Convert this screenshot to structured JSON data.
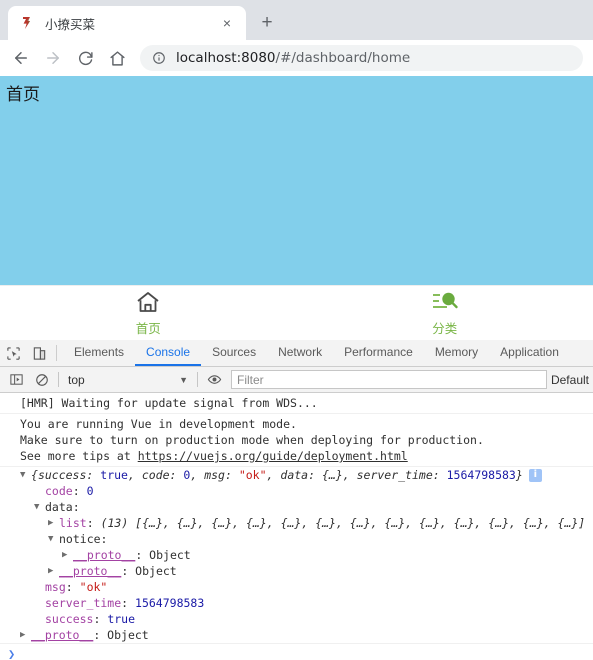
{
  "browser": {
    "tab": {
      "title": "小撩买菜",
      "favicon": "brand-b-icon",
      "close_label": "×"
    },
    "new_tab_label": "+",
    "nav": {
      "back": "back-arrow",
      "forward": "forward-arrow",
      "reload": "reload-arrow",
      "home": "home-outline"
    },
    "omnibox": {
      "security_icon": "info-circle-icon",
      "url_host": "localhost:8080",
      "url_path": "/#/dashboard/home"
    }
  },
  "page": {
    "header_title": "首页",
    "background_color": "#82cfeb",
    "accent_color": "#7ab648",
    "tabbar": [
      {
        "icon": "home-icon",
        "label": "首页"
      },
      {
        "icon": "category-search-icon",
        "label": "分类"
      }
    ]
  },
  "devtools": {
    "tools": {
      "inspect": "inspect-element-icon",
      "device": "device-toolbar-icon"
    },
    "tabs": [
      {
        "label": "Elements",
        "active": false
      },
      {
        "label": "Console",
        "active": true
      },
      {
        "label": "Sources",
        "active": false
      },
      {
        "label": "Network",
        "active": false
      },
      {
        "label": "Performance",
        "active": false
      },
      {
        "label": "Memory",
        "active": false
      },
      {
        "label": "Application",
        "active": false
      }
    ],
    "console_toolbar": {
      "execute_icon": "execute-sidebar-icon",
      "clear_icon": "clear-console-icon",
      "context": "top",
      "caret": "▼",
      "eye_icon": "live-expression-icon",
      "filter_placeholder": "Filter",
      "levels": "Default"
    },
    "console": {
      "messages": [
        {
          "type": "text",
          "lines": [
            "[HMR] Waiting for update signal from WDS..."
          ]
        },
        {
          "type": "text",
          "lines": [
            "You are running Vue in development mode.",
            "Make sure to turn on production mode when deploying for production.",
            "See more tips at "
          ],
          "link": "https://vuejs.org/guide/deployment.html"
        }
      ],
      "object_log": {
        "summary": {
          "triangle": "▼",
          "open": "{",
          "parts": [
            {
              "key": "success",
              "sep": ": ",
              "value": "true",
              "kind": "bool"
            },
            {
              "key": "code",
              "sep": ": ",
              "value": "0",
              "kind": "num"
            },
            {
              "key": "msg",
              "sep": ": ",
              "value": "\"ok\"",
              "kind": "str"
            },
            {
              "key": "data",
              "sep": ": ",
              "value": "{…}",
              "kind": "obj"
            },
            {
              "key": "server_time",
              "sep": ": ",
              "value": "1564798583",
              "kind": "num"
            }
          ],
          "close": "}",
          "badge": "i"
        },
        "rows": [
          {
            "indent": 1,
            "tri": "",
            "key": "code",
            "sep": ": ",
            "value": "0",
            "kind": "num"
          },
          {
            "indent": 1,
            "tri": "▼",
            "key": "data",
            "sep": ":",
            "value": "",
            "kind": "none"
          },
          {
            "indent": 2,
            "tri": "▶",
            "key": "list",
            "sep": ": ",
            "value": "(13) [{…}, {…}, {…}, {…}, {…}, {…}, {…}, {…}, {…}, {…}, {…}, {…}, {…}]",
            "kind": "array"
          },
          {
            "indent": 2,
            "tri": "▼",
            "key": "notice",
            "sep": ":",
            "value": "",
            "kind": "none"
          },
          {
            "indent": 3,
            "tri": "▶",
            "key": "__proto__",
            "sep": ": ",
            "value": "Object",
            "kind": "proto"
          },
          {
            "indent": 2,
            "tri": "▶",
            "key": "__proto__",
            "sep": ": ",
            "value": "Object",
            "kind": "proto"
          },
          {
            "indent": 1,
            "tri": "",
            "key": "msg",
            "sep": ": ",
            "value": "\"ok\"",
            "kind": "str"
          },
          {
            "indent": 1,
            "tri": "",
            "key": "server_time",
            "sep": ": ",
            "value": "1564798583",
            "kind": "num"
          },
          {
            "indent": 1,
            "tri": "",
            "key": "success",
            "sep": ": ",
            "value": "true",
            "kind": "bool"
          },
          {
            "indent": 0,
            "tri": "▶",
            "key": "__proto__",
            "sep": ": ",
            "value": "Object",
            "kind": "proto"
          }
        ]
      },
      "prompt": "❯"
    }
  }
}
